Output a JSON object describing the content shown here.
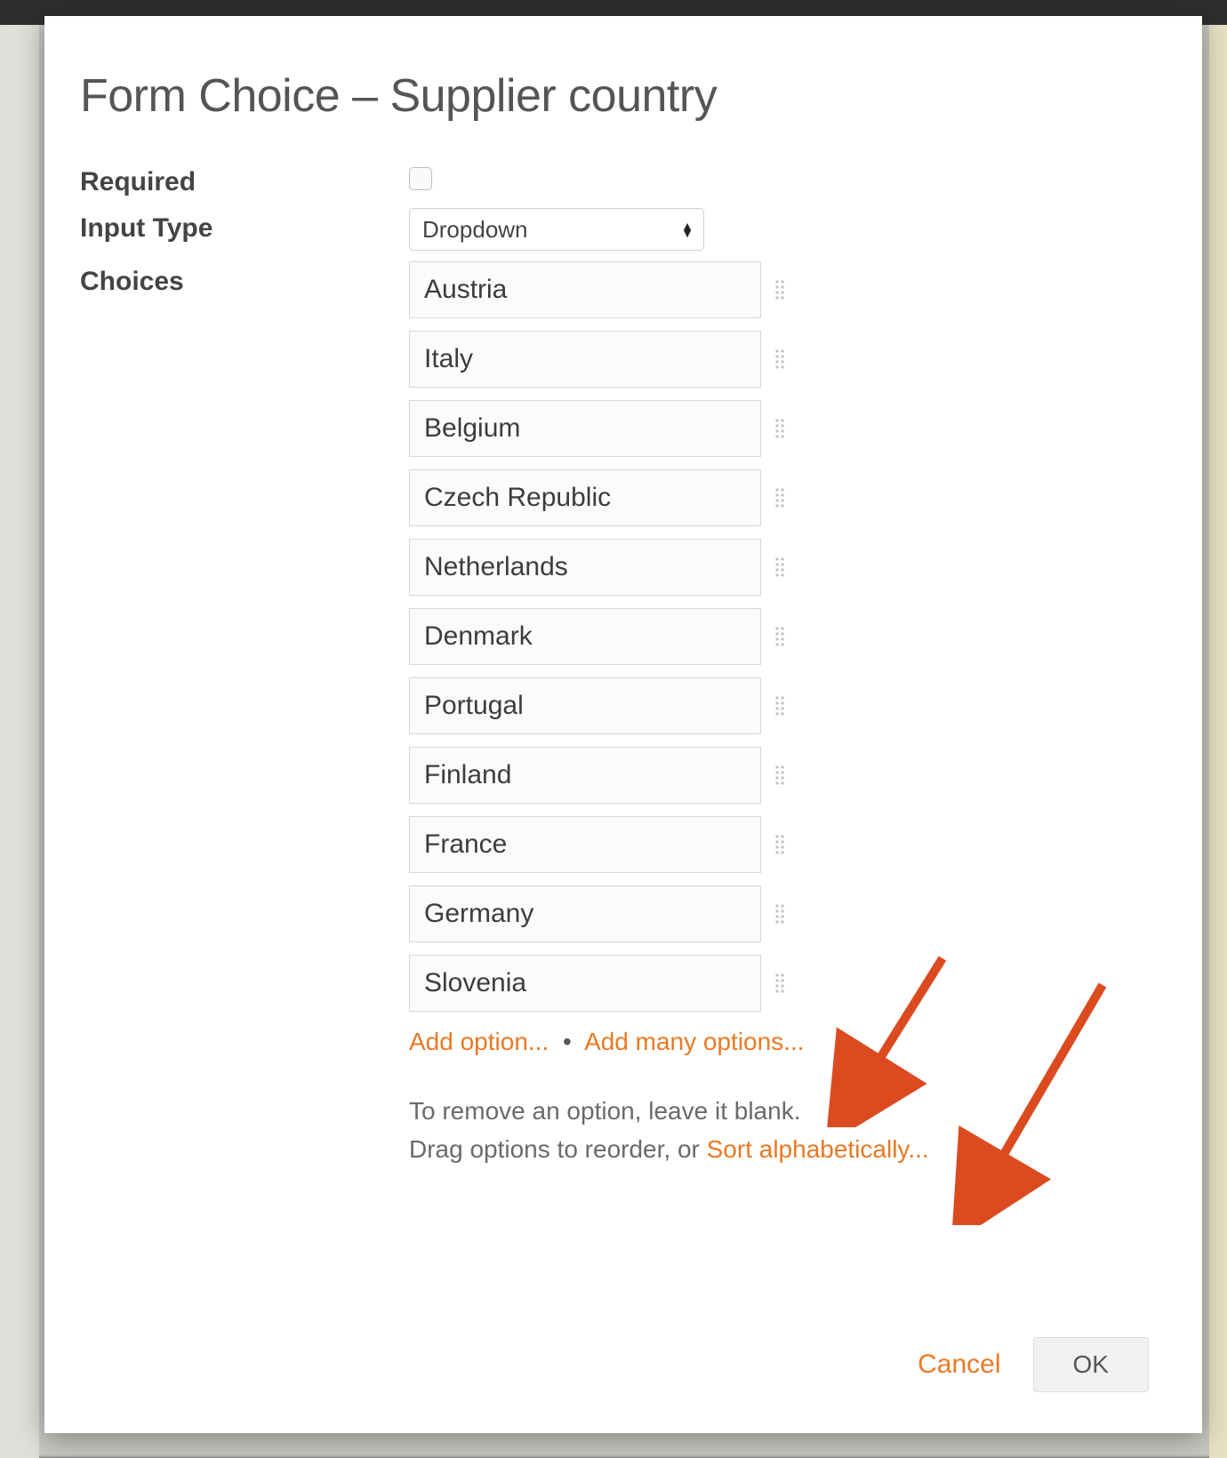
{
  "modal": {
    "title": "Form Choice – Supplier country",
    "labels": {
      "required": "Required",
      "input_type": "Input Type",
      "choices": "Choices"
    },
    "input_type_value": "Dropdown",
    "choices": [
      "Austria",
      "Italy",
      "Belgium",
      "Czech Republic",
      "Netherlands",
      "Denmark",
      "Portugal",
      "Finland",
      "France",
      "Germany",
      "Slovenia"
    ],
    "add_option": "Add option...",
    "add_many": "Add many options...",
    "hint_line1": "To remove an option, leave it blank.",
    "hint_line2_prefix": "Drag options to reorder, or ",
    "sort_link": "Sort alphabetically...",
    "cancel": "Cancel",
    "ok": "OK"
  },
  "colors": {
    "accent": "#e97924"
  }
}
